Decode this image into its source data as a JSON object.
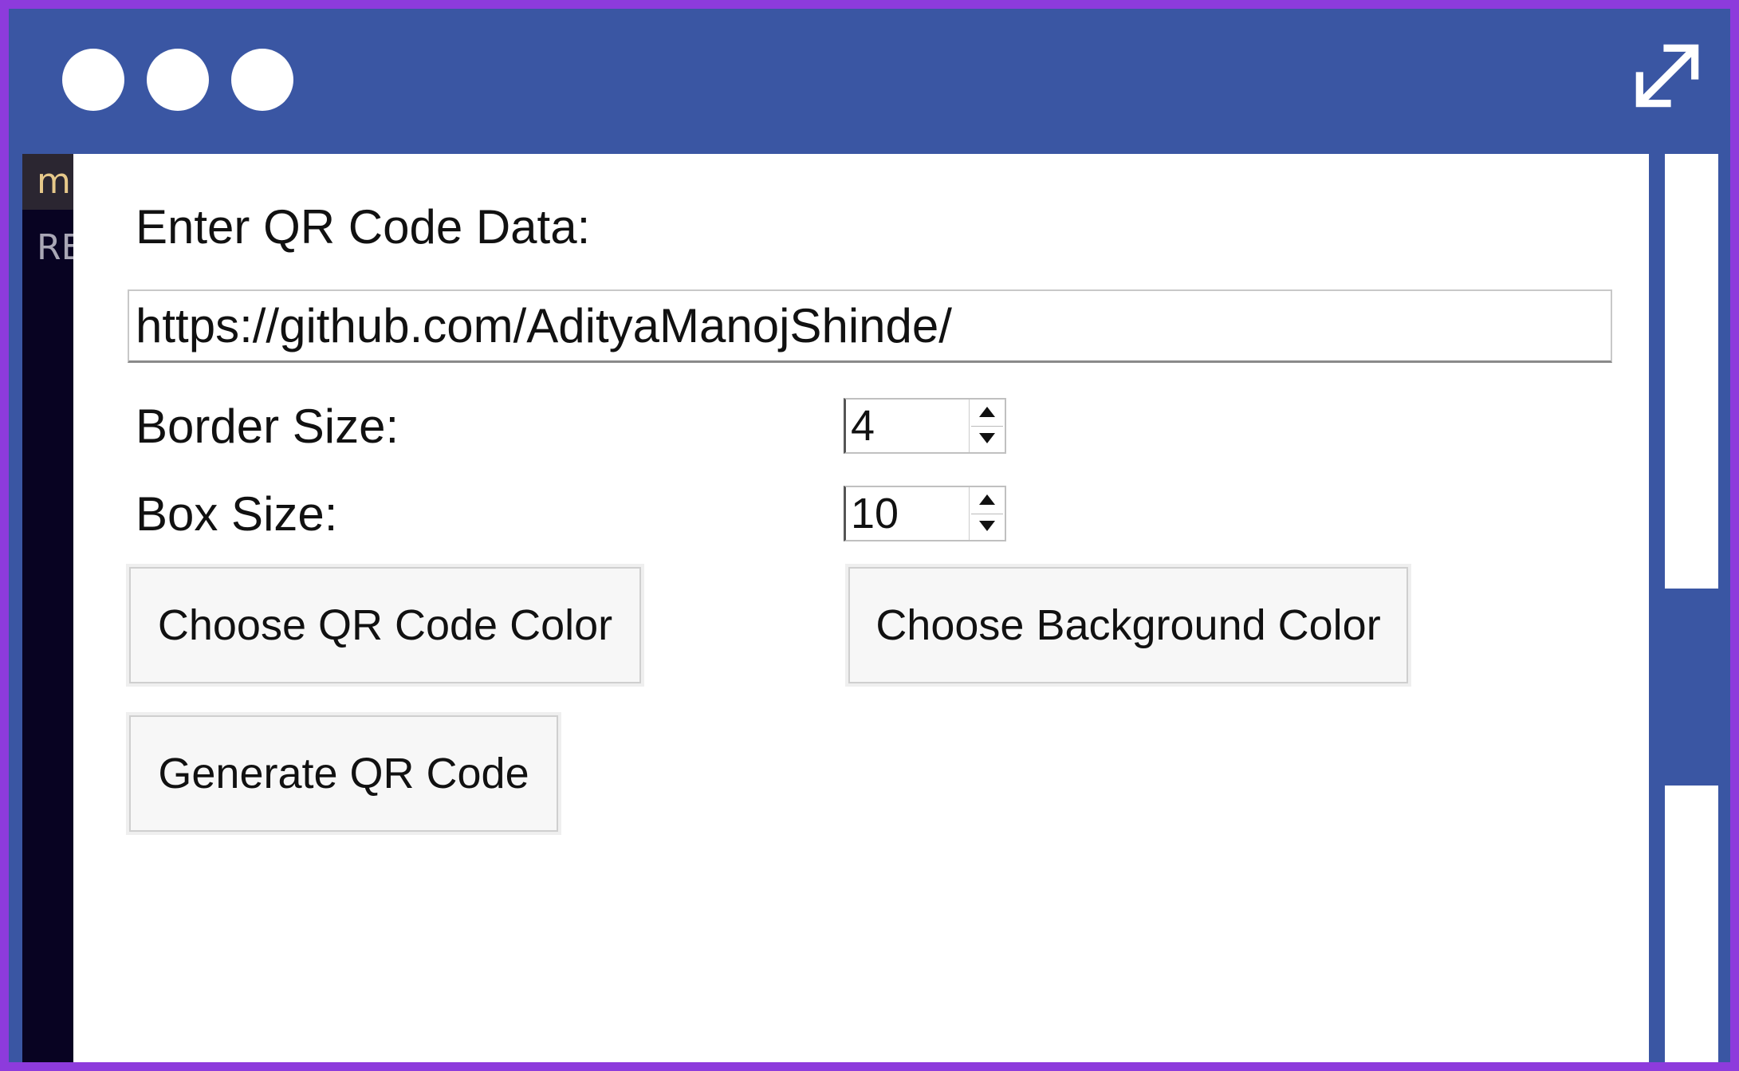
{
  "window": {
    "expand_icon": "expand-icon",
    "dot_icons": [
      "window-dot-icon",
      "window-dot-icon",
      "window-dot-icon"
    ]
  },
  "editor": {
    "tab_fragment": "m",
    "line_fragment": "RE"
  },
  "form": {
    "data_label": "Enter QR Code Data:",
    "data_value": "https://github.com/AdityaManojShinde/",
    "border_label": "Border Size:",
    "border_value": "4",
    "box_label": "Box Size:",
    "box_value": "10",
    "qr_color_button": "Choose QR Code Color",
    "bg_color_button": "Choose Background Color",
    "generate_button": "Generate QR Code"
  },
  "colors": {
    "frame_border": "#8d3bdc",
    "titlebar": "#3a56a3",
    "editor_bg": "#080322"
  }
}
